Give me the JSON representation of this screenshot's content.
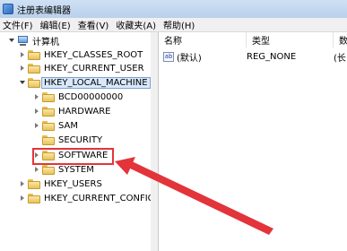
{
  "window": {
    "title": "注册表编辑器"
  },
  "menu": [
    "文件(F)",
    "编辑(E)",
    "查看(V)",
    "收藏夹(A)",
    "帮助(H)"
  ],
  "tree": {
    "root": "计算机",
    "items": [
      "HKEY_CLASSES_ROOT",
      "HKEY_CURRENT_USER",
      "HKEY_LOCAL_MACHINE",
      "BCD00000000",
      "HARDWARE",
      "SAM",
      "SECURITY",
      "SOFTWARE",
      "SYSTEM",
      "HKEY_USERS",
      "HKEY_CURRENT_CONFIG"
    ]
  },
  "list": {
    "columns": [
      "名称",
      "类型",
      "数"
    ],
    "rows": [
      {
        "name": "(默认)",
        "type": "REG_NONE",
        "data": "(长"
      }
    ],
    "value_icon_text": "ab"
  },
  "colors": {
    "highlight": "#e2343a",
    "arrow": "#e2343a",
    "selection": "#d9e8fb"
  }
}
